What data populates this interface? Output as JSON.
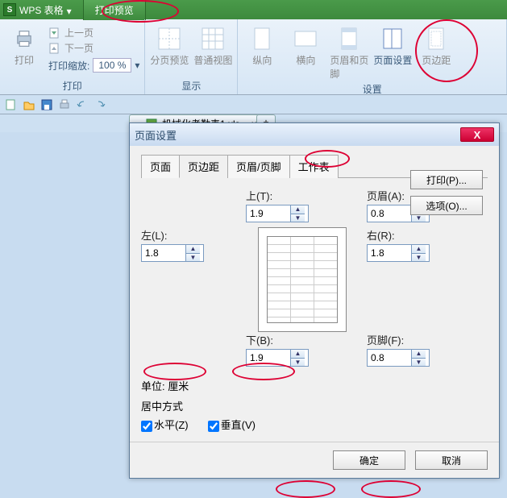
{
  "titlebar": {
    "app_name": "WPS 表格",
    "active_tab": "打印预览"
  },
  "ribbon": {
    "groups": {
      "print": {
        "label": "打印",
        "print_btn": "打印",
        "prev_page": "上一页",
        "next_page": "下一页",
        "zoom_label": "打印缩放:",
        "zoom_value": "100 %"
      },
      "display": {
        "label": "显示",
        "page_break": "分页预览",
        "normal_view": "普通视图"
      },
      "settings": {
        "label": "设置",
        "portrait": "纵向",
        "landscape": "横向",
        "header_footer": "页眉和页脚",
        "page_setup": "页面设置",
        "margins": "页边距"
      }
    }
  },
  "doc": {
    "filename": "机械化考勤表1.xls",
    "add": "+"
  },
  "dialog": {
    "title": "页面设置",
    "tabs": [
      "页面",
      "页边距",
      "页眉/页脚",
      "工作表"
    ],
    "active_tab_index": 1,
    "margins": {
      "top_label": "上(T):",
      "top_value": "1.9",
      "header_label": "页眉(A):",
      "header_value": "0.8",
      "left_label": "左(L):",
      "left_value": "1.8",
      "right_label": "右(R):",
      "right_value": "1.8",
      "bottom_label": "下(B):",
      "bottom_value": "1.9",
      "footer_label": "页脚(F):",
      "footer_value": "0.8"
    },
    "unit_label": "单位: 厘米",
    "center_label": "居中方式",
    "center_h": "水平(Z)",
    "center_v": "垂直(V)",
    "print_btn": "打印(P)...",
    "options_btn": "选项(O)...",
    "ok": "确定",
    "cancel": "取消"
  }
}
